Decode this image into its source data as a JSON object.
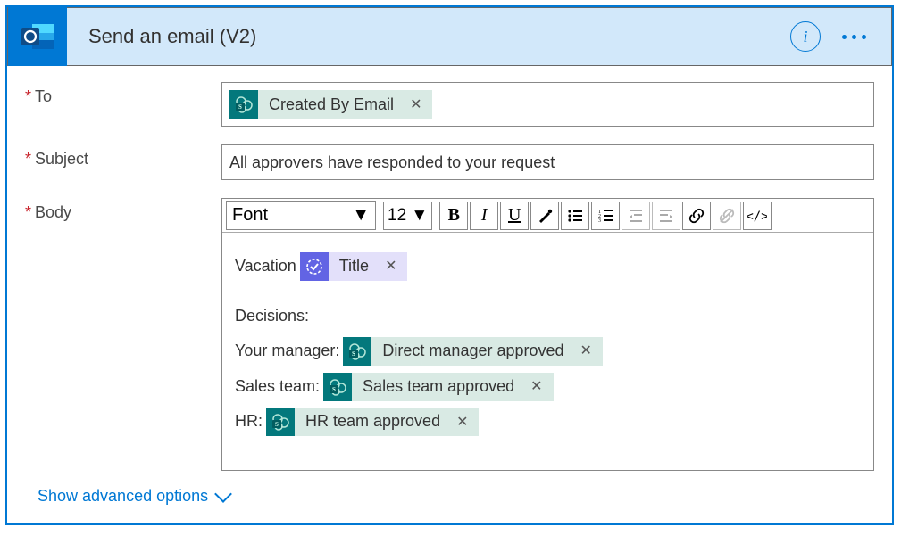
{
  "header": {
    "title": "Send an email (V2)",
    "info_tooltip": "i"
  },
  "fields": {
    "to": {
      "label": "To",
      "token": {
        "label": "Created By Email",
        "source": "sharepoint"
      }
    },
    "subject": {
      "label": "Subject",
      "value": "All approvers have responded to your request"
    },
    "body": {
      "label": "Body",
      "toolbar": {
        "font": "Font",
        "size": "12",
        "bold": "B",
        "italic": "I",
        "underline": "U"
      },
      "content": {
        "line1_prefix": "Vacation",
        "line1_token": {
          "label": "Title",
          "source": "approvals"
        },
        "decisions_label": "Decisions:",
        "rows": [
          {
            "prefix": "Your manager:",
            "token": "Direct manager approved"
          },
          {
            "prefix": "Sales team:",
            "token": "Sales team approved"
          },
          {
            "prefix": "HR:",
            "token": "HR team approved"
          }
        ]
      }
    }
  },
  "advanced": "Show advanced options"
}
